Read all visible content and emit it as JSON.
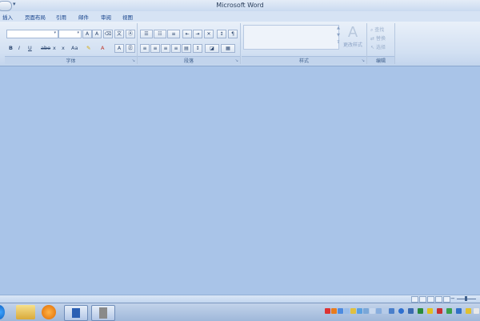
{
  "window": {
    "title": "Microsoft Word"
  },
  "tabs": [
    "插入",
    "页面布局",
    "引用",
    "邮件",
    "审阅",
    "视图"
  ],
  "ribbon": {
    "groups": {
      "font": "字体",
      "paragraph": "段落",
      "styles": "样式",
      "editing": "编辑"
    },
    "font_buttons_row1": [
      "A",
      "A"
    ],
    "font_buttons_row2": [
      "B",
      "I",
      "U",
      "abe",
      "x",
      "x",
      "Aa",
      "A",
      "A"
    ],
    "change_styles_label": "更改样式",
    "editing_items": [
      "查找",
      "替换",
      "选择"
    ]
  },
  "icons": {
    "office_button": "office-orb-icon",
    "qat_dropdown": "dropdown-arrow-icon",
    "bullets": "bullets-icon",
    "numbering": "numbering-icon",
    "align": "align-icon",
    "change_styles": "change-styles-icon",
    "find": "binoculars-icon",
    "replace": "replace-icon",
    "select": "select-icon"
  },
  "colors": {
    "background": "#a9c4e8",
    "ribbon_top": "#e9f0f9",
    "accent": "#15428b"
  }
}
